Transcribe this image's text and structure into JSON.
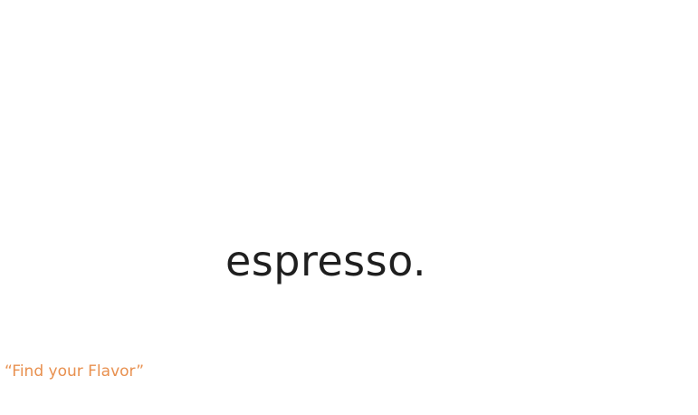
{
  "brand": {
    "title": "espresso."
  },
  "tagline": {
    "text": "“Find your Flavor”"
  },
  "colors": {
    "background": "#ffffff",
    "title": "#1f1f1f",
    "accent": "#e8904f"
  }
}
